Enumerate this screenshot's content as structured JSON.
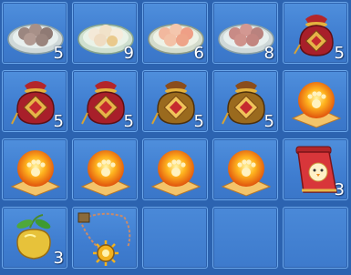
{
  "inventory": {
    "slots": [
      {
        "icon": "rice-ball-plate-icon",
        "count": "5"
      },
      {
        "icon": "tangyuan-plate-icon",
        "count": "9"
      },
      {
        "icon": "peach-bun-plate-icon",
        "count": "6"
      },
      {
        "icon": "sesame-ball-plate-icon",
        "count": "8"
      },
      {
        "icon": "lucky-bag-icon",
        "count": "5"
      },
      {
        "icon": "lucky-bag-icon",
        "count": "5"
      },
      {
        "icon": "lucky-bag-icon",
        "count": "5"
      },
      {
        "icon": "gold-lucky-bag-icon",
        "count": "5"
      },
      {
        "icon": "gold-lucky-bag-icon",
        "count": "5"
      },
      {
        "icon": "paw-orb-icon",
        "count": ""
      },
      {
        "icon": "paw-orb-icon",
        "count": ""
      },
      {
        "icon": "paw-orb-icon",
        "count": ""
      },
      {
        "icon": "paw-orb-icon",
        "count": ""
      },
      {
        "icon": "paw-orb-icon",
        "count": ""
      },
      {
        "icon": "chick-scroll-icon",
        "count": "3"
      },
      {
        "icon": "golden-fruit-icon",
        "count": "3"
      },
      {
        "icon": "sun-amulet-necklace-icon",
        "count": ""
      },
      {
        "icon": "",
        "count": ""
      },
      {
        "icon": "",
        "count": ""
      },
      {
        "icon": "",
        "count": ""
      }
    ]
  }
}
